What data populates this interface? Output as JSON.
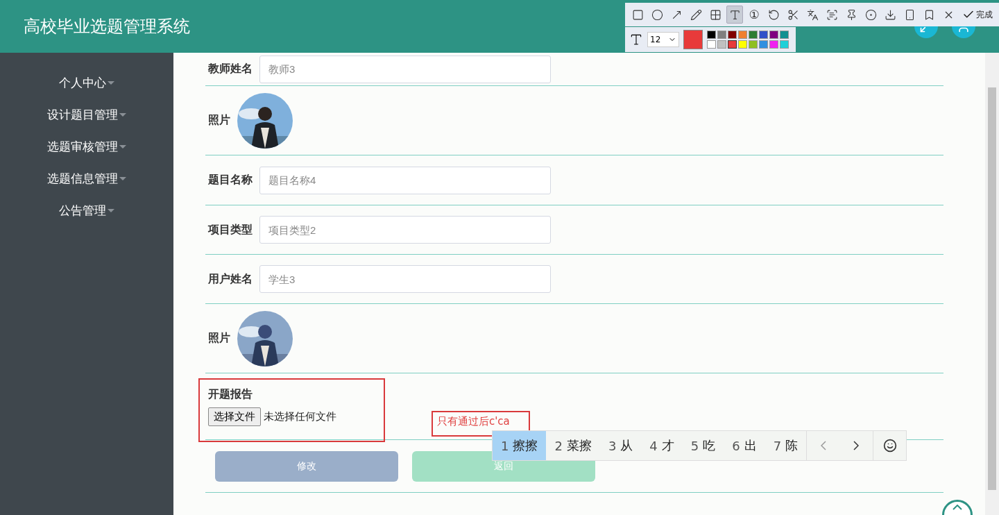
{
  "header": {
    "title": "高校毕业选题管理系统",
    "actions": [
      {
        "kind": "fullscreen"
      },
      {
        "kind": "user"
      }
    ]
  },
  "sidebar": {
    "items": [
      {
        "label": "个人中心"
      },
      {
        "label": "设计题目管理"
      },
      {
        "label": "选题审核管理"
      },
      {
        "label": "选题信息管理"
      },
      {
        "label": "公告管理"
      }
    ]
  },
  "form": {
    "fields": [
      {
        "kind": "input",
        "label": "教师姓名",
        "placeholder": "教师3"
      },
      {
        "label": "照片"
      },
      {
        "kind": "input",
        "label": "题目名称",
        "placeholder": "题目名称4"
      },
      {
        "kind": "input",
        "label": "项目类型",
        "placeholder": "项目类型2"
      },
      {
        "kind": "input",
        "label": "用户姓名",
        "placeholder": "学生3"
      },
      {
        "label": "照片"
      },
      {
        "kind": "file",
        "label": "开题报告",
        "button": "选择文件",
        "status": "未选择任何文件",
        "note": "只有通过后c'ca"
      }
    ],
    "buttons": [
      {
        "kind": "edit",
        "label": "修改"
      },
      {
        "kind": "back",
        "label": "返回"
      }
    ]
  },
  "capture_toolbar": {
    "tools": [
      {
        "kind": "rect",
        "selected": false
      },
      {
        "kind": "circle",
        "selected": false
      },
      {
        "kind": "arrow",
        "selected": false
      },
      {
        "kind": "pencil",
        "selected": false
      },
      {
        "kind": "mosaic",
        "selected": false
      },
      {
        "kind": "text",
        "selected": true
      },
      {
        "kind": "number",
        "glyph": "①",
        "selected": false
      },
      {
        "kind": "undo",
        "selected": false
      },
      {
        "kind": "cut",
        "selected": false
      },
      {
        "kind": "translate",
        "selected": false
      },
      {
        "kind": "scan",
        "selected": false
      },
      {
        "kind": "pin",
        "selected": false
      },
      {
        "kind": "record",
        "selected": false
      },
      {
        "kind": "download",
        "selected": false
      },
      {
        "kind": "phone",
        "selected": false
      },
      {
        "kind": "bookmark",
        "selected": false
      },
      {
        "kind": "close",
        "selected": false
      }
    ],
    "done": "完成",
    "font_size": "12",
    "swatches": [
      {
        "color": "#000000",
        "selected": false
      },
      {
        "color": "#7f7f7f",
        "selected": false
      },
      {
        "color": "#800000",
        "selected": false
      },
      {
        "color": "#f08030",
        "selected": false
      },
      {
        "color": "#2e7d32",
        "selected": false
      },
      {
        "color": "#3050c8",
        "selected": false
      },
      {
        "color": "#800080",
        "selected": false
      },
      {
        "color": "#109090",
        "selected": false
      },
      {
        "color": "#ffffff",
        "selected": false
      },
      {
        "color": "#c0c0c0",
        "selected": false
      },
      {
        "color": "#e83a3a",
        "selected": true
      },
      {
        "color": "#ffff00",
        "selected": false
      },
      {
        "color": "#8fbf20",
        "selected": false
      },
      {
        "color": "#3090e0",
        "selected": false
      },
      {
        "color": "#f020f0",
        "selected": false
      },
      {
        "color": "#20d0d8",
        "selected": false
      }
    ]
  },
  "ime": {
    "candidates": [
      {
        "index": "1",
        "text": "擦擦",
        "selected": true
      },
      {
        "index": "2",
        "text": "菜擦",
        "selected": false
      },
      {
        "index": "3",
        "text": "从",
        "selected": false
      },
      {
        "index": "4",
        "text": "才",
        "selected": false
      },
      {
        "index": "5",
        "text": "吃",
        "selected": false
      },
      {
        "index": "6",
        "text": "出",
        "selected": false
      },
      {
        "index": "7",
        "text": "陈",
        "selected": false
      }
    ]
  }
}
